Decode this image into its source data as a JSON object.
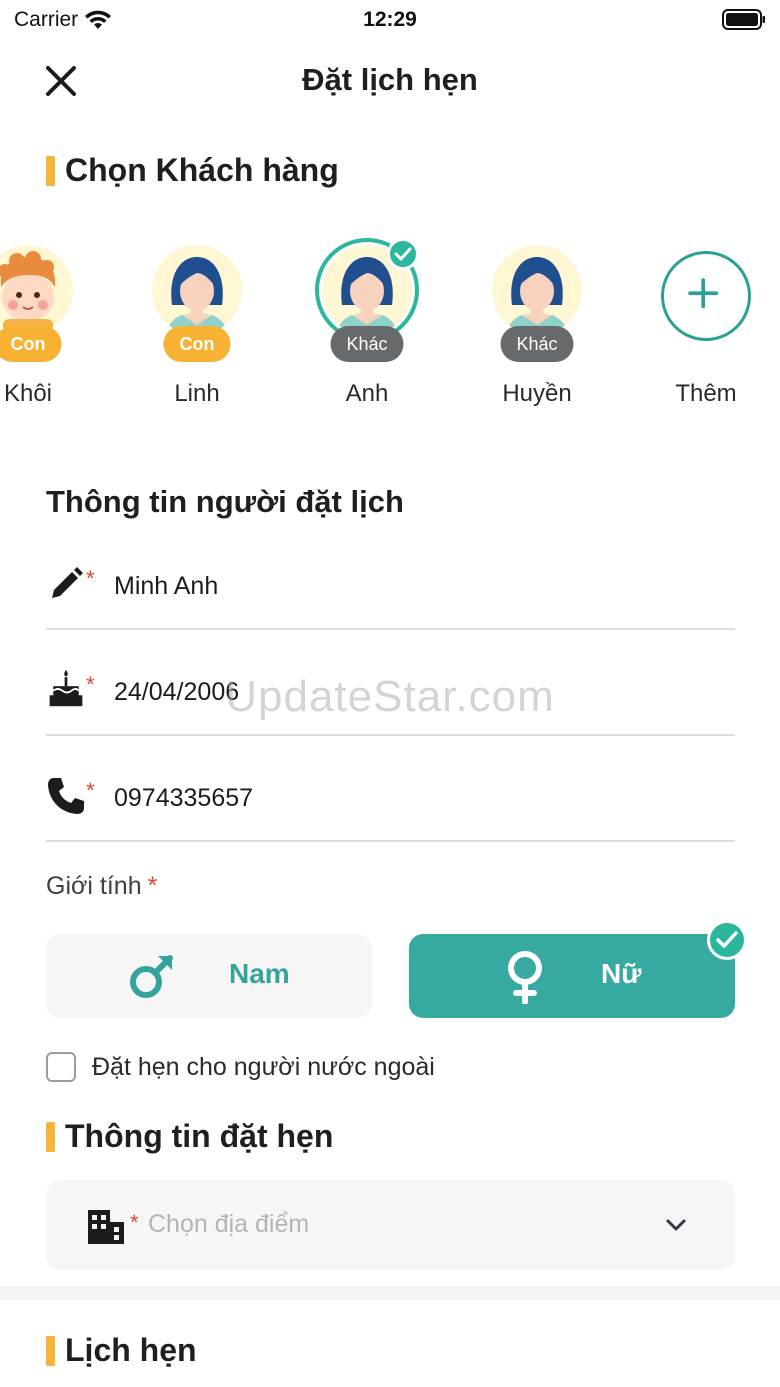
{
  "status_bar": {
    "carrier": "Carrier",
    "time": "12:29"
  },
  "header": {
    "title": "Đặt lịch hẹn"
  },
  "customers_section": {
    "title": "Chọn Khách hàng",
    "items": [
      {
        "name": "Khôi",
        "role": "Con",
        "avatar": "boy-avatar",
        "selected": false
      },
      {
        "name": "Linh",
        "role": "Con",
        "avatar": "girl-avatar",
        "selected": false
      },
      {
        "name": "Anh",
        "role": "Khác",
        "avatar": "girl-avatar",
        "selected": true
      },
      {
        "name": "Huyền",
        "role": "Khác",
        "avatar": "girl-avatar",
        "selected": false
      }
    ],
    "add_label": "Thêm"
  },
  "booker": {
    "title": "Thông tin người đặt lịch",
    "name": "Minh Anh",
    "dob": "24/04/2006",
    "phone": "0974335657",
    "required_mark": "*"
  },
  "gender": {
    "label": "Giới tính",
    "required_mark": "*",
    "male_label": "Nam",
    "female_label": "Nữ",
    "selected": "female"
  },
  "foreign_option": {
    "label": "Đặt hẹn cho người nước ngoài",
    "checked": false
  },
  "appointment": {
    "title": "Thông tin đặt hẹn",
    "location_placeholder": "Chọn địa điểm",
    "required_mark": "*"
  },
  "schedule": {
    "title": "Lịch hẹn"
  },
  "watermark": "UpdateStar.com",
  "colors": {
    "accent": "#36aaa1",
    "check": "#2bb79c",
    "section_bar": "#f5b53a",
    "badge_con": "#f7b233",
    "badge_khac": "#666a6c",
    "required": "#e0463c"
  }
}
